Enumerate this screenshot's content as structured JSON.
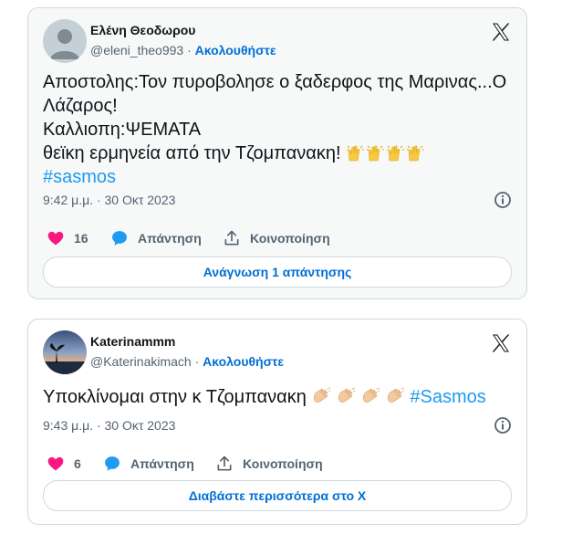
{
  "tweets": [
    {
      "author_name": "Ελένη Θεοδωρου",
      "handle": "@eleni_theo993",
      "separator": "·",
      "follow_label": "Ακολουθήστε",
      "text_lines": [
        "Αποστολης:Τον πυροβολησε ο ξαδερφος της Μαρινας...Ο",
        "Λάζαρος!",
        "Καλλιοπη:ΨΕΜΑΤΑ",
        "θεϊκη ερμηνεία από την Τζομπανακη!"
      ],
      "hashtag": "#sasmos",
      "time": "9:42 μ.μ. · 30 Οκτ 2023",
      "likes": "16",
      "reply_label": "Απάντηση",
      "share_label": "Κοινοποίηση",
      "button_label": "Ανάγνωση 1 απάντησης"
    },
    {
      "author_name": "Katerinammm",
      "handle": "@Katerinakimach",
      "separator": "·",
      "follow_label": "Ακολουθήστε",
      "text": "Υποκλίνομαι στην κ Τζομπανακη",
      "hashtag": "#Sasmos",
      "time": "9:43 μ.μ. · 30 Οκτ 2023",
      "likes": "6",
      "reply_label": "Απάντηση",
      "share_label": "Κοινοποίηση",
      "button_label": "Διαβάστε περισσότερα στο X"
    }
  ],
  "icons": {
    "logo": "x-logo-icon",
    "like": "heart-icon",
    "reply": "speech-bubble-icon",
    "share": "share-upload-icon",
    "info": "info-icon"
  },
  "colors": {
    "link": "#006fd6",
    "hashtag": "#1d9bf0",
    "heart": "#f91880",
    "reply_bubble": "#1d9bf0",
    "muted": "#536471",
    "border": "#cfd9de"
  }
}
